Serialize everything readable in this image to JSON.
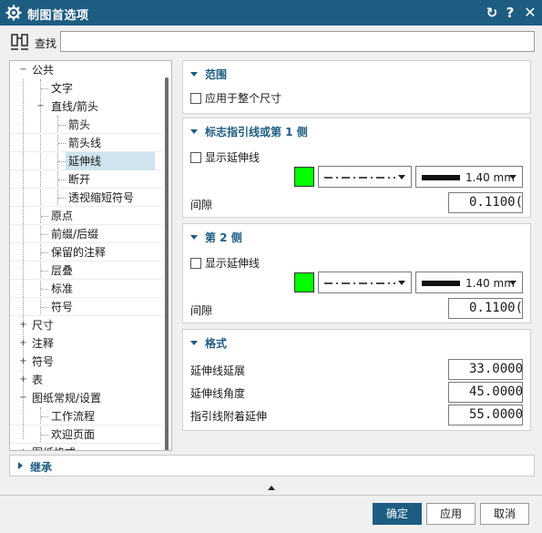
{
  "window": {
    "title": "制图首选项",
    "reset_icon": "↻",
    "help_icon": "?",
    "close_icon": "✕"
  },
  "find": {
    "label": "查找",
    "value": "",
    "placeholder": ""
  },
  "tree": {
    "items": [
      {
        "label": "公共",
        "toggle": "−"
      },
      {
        "label": "文字",
        "toggle": ""
      },
      {
        "label": "直线/箭头",
        "toggle": "−"
      },
      {
        "label": "箭头",
        "toggle": ""
      },
      {
        "label": "箭头线",
        "toggle": ""
      },
      {
        "label": "延伸线",
        "toggle": ""
      },
      {
        "label": "断开",
        "toggle": ""
      },
      {
        "label": "透视缩短符号",
        "toggle": ""
      },
      {
        "label": "原点",
        "toggle": ""
      },
      {
        "label": "前缀/后缀",
        "toggle": ""
      },
      {
        "label": "保留的注释",
        "toggle": ""
      },
      {
        "label": "层叠",
        "toggle": ""
      },
      {
        "label": "标准",
        "toggle": ""
      },
      {
        "label": "符号",
        "toggle": ""
      },
      {
        "label": "尺寸",
        "toggle": "+"
      },
      {
        "label": "注释",
        "toggle": "+"
      },
      {
        "label": "符号",
        "toggle": "+"
      },
      {
        "label": "表",
        "toggle": "+"
      },
      {
        "label": "图纸常规/设置",
        "toggle": "−"
      },
      {
        "label": "工作流程",
        "toggle": ""
      },
      {
        "label": "欢迎页面",
        "toggle": ""
      },
      {
        "label": "图纸格式",
        "toggle": "+"
      }
    ]
  },
  "scope": {
    "title": "范围",
    "apply_whole_label": "应用于整个尺寸",
    "apply_whole_checked": false
  },
  "side1": {
    "title": "标志指引线或第 1 侧",
    "show_ext_label": "显示延伸线",
    "show_ext_checked": false,
    "color": "#00ff00",
    "line_style": "dash-dot",
    "line_width": "1.40 mm",
    "gap_label": "间隙",
    "gap_value": "0.1100("
  },
  "side2": {
    "title": "第 2 侧",
    "show_ext_label": "显示延伸线",
    "show_ext_checked": false,
    "color": "#00ff00",
    "line_style": "dash-dot",
    "line_width": "1.40 mm",
    "gap_label": "间隙",
    "gap_value": "0.1100("
  },
  "format": {
    "title": "格式",
    "rows": [
      {
        "label": "延伸线延展",
        "value": "33.0000("
      },
      {
        "label": "延伸线角度",
        "value": "45.0000("
      },
      {
        "label": "指引线附着延伸",
        "value": "55.0000("
      }
    ]
  },
  "inherit": {
    "title": "继承"
  },
  "buttons": {
    "ok": "确定",
    "apply": "应用",
    "cancel": "取消"
  },
  "colors": {
    "accent": "#1e5d82",
    "selection": "#cfe4ee"
  }
}
